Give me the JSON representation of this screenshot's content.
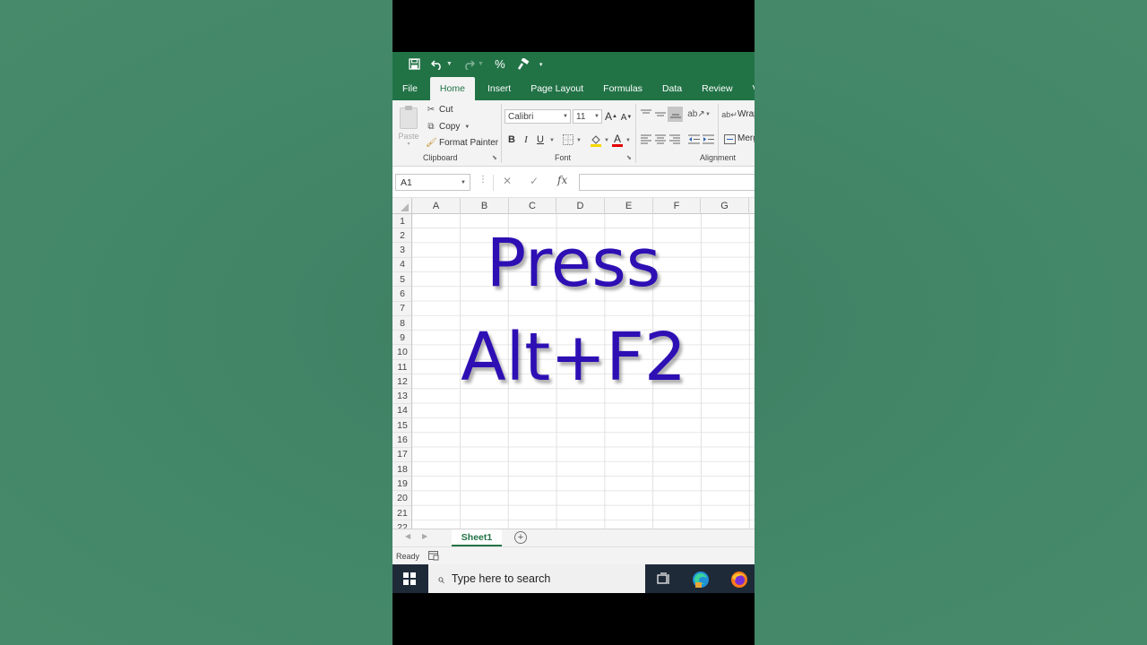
{
  "quick_access": {
    "icons": [
      "save-icon",
      "undo-icon",
      "redo-icon",
      "percent-icon",
      "format-painter-icon",
      "customize-icon"
    ],
    "percent_label": "%"
  },
  "tabs": [
    "File",
    "Home",
    "Insert",
    "Page Layout",
    "Formulas",
    "Data",
    "Review",
    "View"
  ],
  "tabs_visible": [
    "File",
    "Home",
    "Insert",
    "Page Layout",
    "Formulas",
    "Data",
    "Review",
    "Vie"
  ],
  "active_tab": "Home",
  "ribbon": {
    "clipboard": {
      "paste_label": "Paste",
      "cut_label": "Cut",
      "copy_label": "Copy",
      "format_painter_label": "Format Painter",
      "group_label": "Clipboard"
    },
    "font": {
      "font_name": "Calibri",
      "font_size": "11",
      "bold": "B",
      "italic": "I",
      "underline": "U",
      "font_color_letter": "A",
      "group_label": "Font"
    },
    "alignment": {
      "wrap_label": "Wrap",
      "merge_label": "Merg",
      "group_label": "Alignment"
    }
  },
  "formula_bar": {
    "name_box": "A1",
    "fx_label": "fx",
    "value": ""
  },
  "columns": [
    "A",
    "B",
    "C",
    "D",
    "E",
    "F",
    "G"
  ],
  "rows": [
    "1",
    "2",
    "3",
    "4",
    "5",
    "6",
    "7",
    "8",
    "9",
    "10",
    "11",
    "12",
    "13",
    "14",
    "15",
    "16",
    "17",
    "18",
    "19",
    "20",
    "21",
    "22"
  ],
  "overlay": {
    "line1": "Press",
    "line2": "Alt+F2",
    "color": "#2d0fb4"
  },
  "sheet_tabs": {
    "active_sheet": "Sheet1",
    "add_label": "+"
  },
  "status": {
    "ready": "Ready"
  },
  "taskbar": {
    "search_placeholder": "Type here to search",
    "accent": "#217346"
  }
}
